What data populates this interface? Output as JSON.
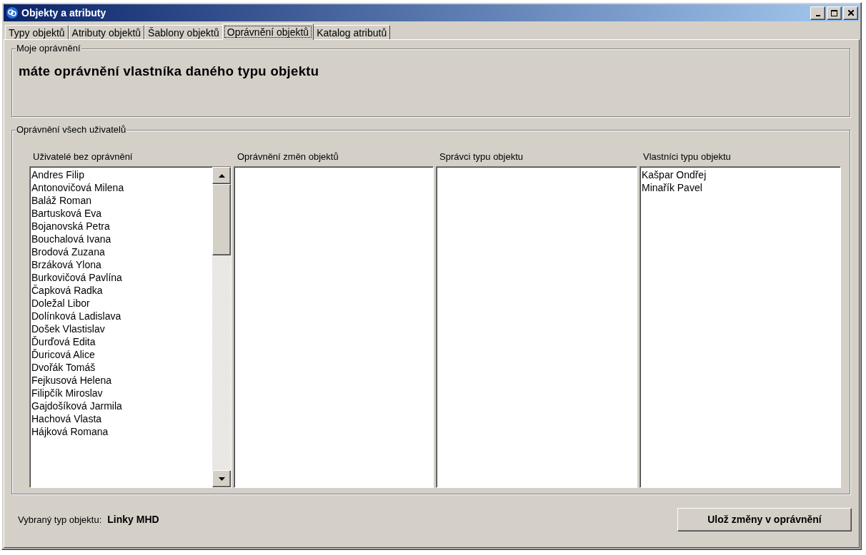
{
  "window": {
    "title": "Objekty a atributy"
  },
  "tabs": [
    {
      "label": "Typy objektů",
      "selected": false
    },
    {
      "label": "Atributy objektů",
      "selected": false
    },
    {
      "label": "Šablony objektů",
      "selected": false
    },
    {
      "label": "Oprávnění objektů",
      "selected": true
    },
    {
      "label": "Katalog atributů",
      "selected": false
    }
  ],
  "my_permissions": {
    "title": "Moje oprávnění",
    "text": "máte oprávnění vlastníka daného typu objektu"
  },
  "all_permissions": {
    "title": "Oprávnění všech uživatelů",
    "lists": [
      {
        "header": "Uživatelé bez oprávnění",
        "scrollbar": true,
        "items": [
          "Andres Filip",
          "Antonovičová Milena",
          "Baláž Roman",
          "Bartusková Eva",
          "Bojanovská Petra",
          "Bouchalová Ivana",
          "Brodová Zuzana",
          "Brzáková Ylona",
          "Burkovičová Pavlína",
          "Čapková Radka",
          "Doležal Libor",
          "Dolínková Ladislava",
          "Došek Vlastislav",
          "Ďurďová Edita",
          "Ďuricová Alice",
          "Dvořák Tomáš",
          "Fejkusová Helena",
          "Filipčík Miroslav",
          "Gajdošíková Jarmila",
          "Hachová Vlasta",
          "Hájková Romana"
        ]
      },
      {
        "header": "Oprávnění změn objektů",
        "scrollbar": false
      },
      {
        "header": "Správci typu objektu",
        "scrollbar": false
      },
      {
        "header": "Vlastníci typu objektu",
        "scrollbar": false,
        "items": [
          "Kašpar Ondřej",
          "Minařík Pavel"
        ]
      }
    ]
  },
  "footer": {
    "label": "Vybraný typ objektu:",
    "value": "Linky MHD",
    "button": "Ulož změny v oprávnění"
  }
}
